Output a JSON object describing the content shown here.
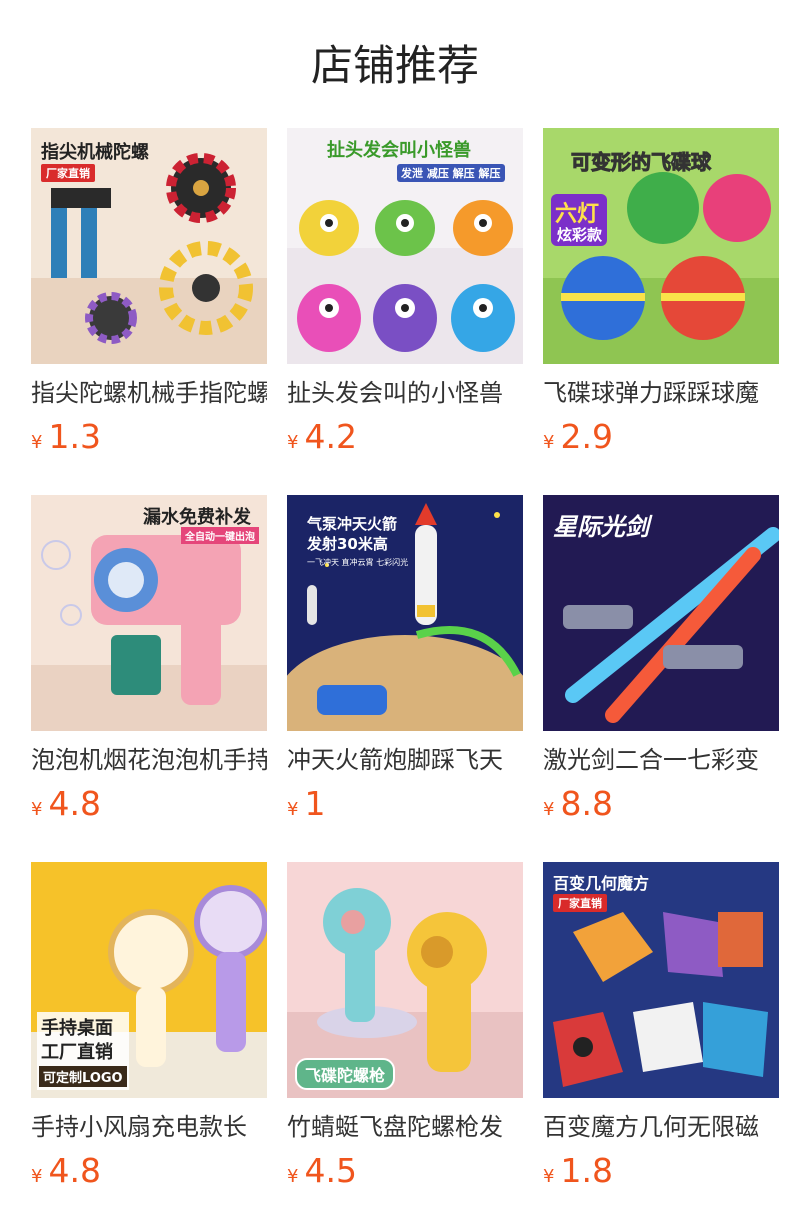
{
  "page": {
    "title": "店铺推荐"
  },
  "currency": "¥",
  "products": [
    {
      "name": "指尖陀螺机械手指陀螺",
      "price": "1.3",
      "image_text": [
        "指尖机械陀螺",
        "厂家直销"
      ],
      "icon": "fidget-spinner-image"
    },
    {
      "name": "扯头发会叫的小怪兽",
      "price": "4.2",
      "image_text": [
        "扯头发会叫小怪兽",
        "发泄 减压 解压 解压"
      ],
      "icon": "monster-toy-image"
    },
    {
      "name": "飞碟球弹力踩踩球魔",
      "price": "2.9",
      "image_text": [
        "可变形的飞碟球",
        "六灯",
        "炫彩款"
      ],
      "icon": "ufo-ball-image"
    },
    {
      "name": "泡泡机烟花泡泡机手持",
      "price": "4.8",
      "image_text": [
        "漏水免费补发",
        "全自动一键出泡"
      ],
      "icon": "bubble-gun-image"
    },
    {
      "name": "冲天火箭炮脚踩飞天",
      "price": "1",
      "image_text": [
        "气泵冲天火箭",
        "发射30米高",
        "一飞冲天 直冲云霄 七彩闪光"
      ],
      "icon": "rocket-launcher-image"
    },
    {
      "name": "激光剑二合一七彩变",
      "price": "8.8",
      "image_text": [
        "星际光剑"
      ],
      "icon": "lightsaber-image"
    },
    {
      "name": "手持小风扇充电款长",
      "price": "4.8",
      "image_text": [
        "手持桌面",
        "工厂直销",
        "可定制LOGO"
      ],
      "icon": "handheld-fan-image"
    },
    {
      "name": "竹蜻蜓飞盘陀螺枪发",
      "price": "4.5",
      "image_text": [
        "飞碟陀螺枪"
      ],
      "icon": "disc-launcher-image"
    },
    {
      "name": "百变魔方几何无限磁",
      "price": "1.8",
      "image_text": [
        "百变几何魔方",
        "厂家直销"
      ],
      "icon": "magic-cube-image"
    }
  ],
  "colors": {
    "price": "#f0551d",
    "title": "#222222"
  }
}
